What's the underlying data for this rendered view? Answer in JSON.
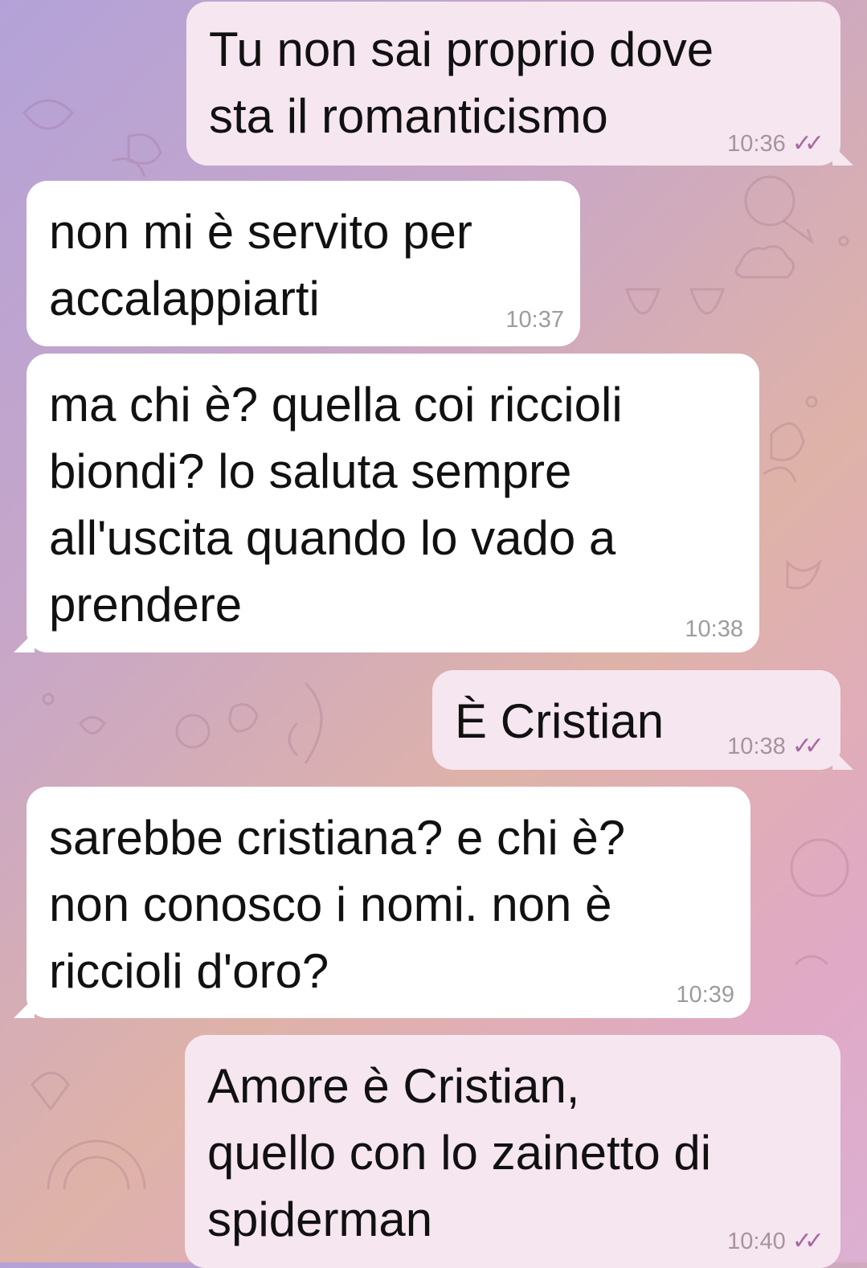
{
  "chat": {
    "messages": [
      {
        "direction": "outgoing",
        "text": "Tu non sai proprio dove\nsta il romanticismo",
        "time": "10:36",
        "status": "read"
      },
      {
        "direction": "incoming",
        "text": "non mi è servito per\naccalappiarti",
        "time": "10:37"
      },
      {
        "direction": "incoming",
        "text": "ma chi è? quella coi riccioli\nbiondi? lo saluta sempre\nall'uscita quando lo vado a\nprendere",
        "time": "10:38"
      },
      {
        "direction": "outgoing",
        "text": "È Cristian",
        "time": "10:38",
        "status": "read"
      },
      {
        "direction": "incoming",
        "text": "sarebbe cristiana? e chi è?\nnon conosco i nomi. non è\nriccioli d'oro?",
        "time": "10:39"
      },
      {
        "direction": "outgoing",
        "text": "Amore è Cristian,\nquello con lo zainetto di\nspiderman",
        "time": "10:40",
        "status": "read"
      }
    ]
  },
  "colors": {
    "outgoing_bubble": "#f6e6f0",
    "incoming_bubble": "#ffffff",
    "read_ticks": "#a66aa1"
  },
  "icons": {
    "read_status": "double-check-icon"
  }
}
